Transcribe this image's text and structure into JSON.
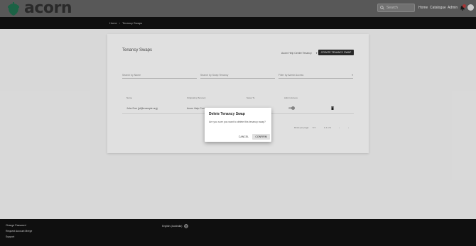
{
  "brand": {
    "name": "acorn"
  },
  "header": {
    "search_placeholder": "Search",
    "nav": {
      "home": "Home",
      "catalogue": "Catalogue",
      "admin": "Admin"
    }
  },
  "breadcrumb": {
    "home": "Home",
    "separator": "›",
    "current": "Tenancy Swaps"
  },
  "page": {
    "title": "Tenancy Swaps",
    "tenancy_select": "Acorn Help Centre Tenancy",
    "create_button": "CREATE TENANCY SWAP",
    "filters": {
      "name": "Search by Name",
      "swap": "Search by Swap Tenancy",
      "admin": "Filter by Admin Access"
    },
    "table": {
      "headers": [
        "Name",
        "Originating Tenancy",
        "Swap To",
        "Admin Access"
      ],
      "rows": [
        {
          "name": "John Doe (jd@example.org)",
          "originating": "Acorn Help Cent"
        }
      ]
    },
    "pager": {
      "rows_label": "Rows per page:",
      "rows_value": "5 ▾",
      "range": "1-1 of 1"
    }
  },
  "dialog": {
    "title": "Delete Tenancy Swap",
    "message": "Are you sure you want to delete this tenancy swap?",
    "cancel": "CANCEL",
    "confirm": "CONFIRM"
  },
  "footer": {
    "links": [
      "Change Password",
      "Request Account Merge",
      "Support"
    ],
    "language": "English (Australia)"
  },
  "colors": {
    "header_bg": "#5f5f5f",
    "bar_bg": "#111111",
    "card_bg": "#f2f2f2",
    "primary_button": "#2a2a2a",
    "logo_green": "#1f6a4b"
  }
}
